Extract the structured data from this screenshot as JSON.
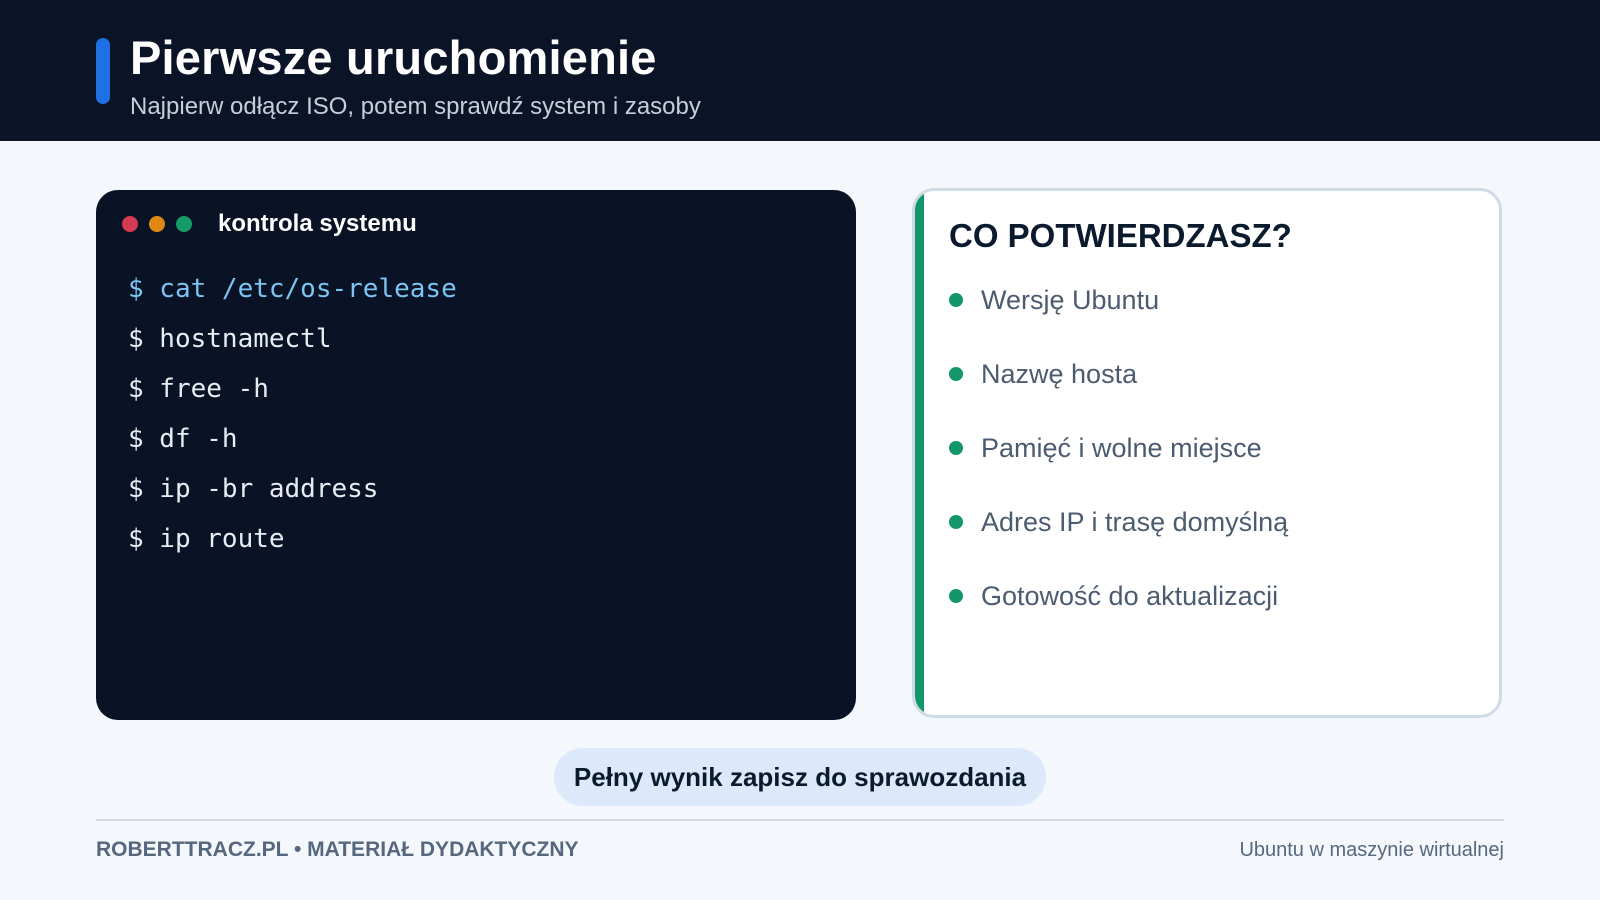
{
  "header": {
    "title": "Pierwsze uruchomienie",
    "subtitle": "Najpierw odłącz ISO, potem sprawdź system i zasoby"
  },
  "terminal": {
    "title": "kontrola systemu",
    "window_dots": [
      "red-dot-icon",
      "orange-dot-icon",
      "green-dot-icon"
    ],
    "commands": [
      "$ cat /etc/os-release",
      "$ hostnamectl",
      "$ free -h",
      "$ df -h",
      "$ ip -br address",
      "$ ip route"
    ]
  },
  "panel": {
    "title": "CO POTWIERDZASZ?",
    "items": [
      "Wersję Ubuntu",
      "Nazwę hosta",
      "Pamięć i wolne miejsce",
      "Adres IP i trasę domyślną",
      "Gotowość do aktualizacji"
    ]
  },
  "note": "Pełny wynik zapisz do sprawozdania",
  "footer": {
    "left": "ROBERTTRACZ.PL • MATERIAŁ DYDAKTYCZNY",
    "right": "Ubuntu w maszynie wirtualnej"
  },
  "colors": {
    "header_bg": "#0a1426",
    "accent_blue": "#1f6fe5",
    "accent_green": "#13966a",
    "terminal_bg": "#091325",
    "command_highlight": "#7cc4f2"
  }
}
